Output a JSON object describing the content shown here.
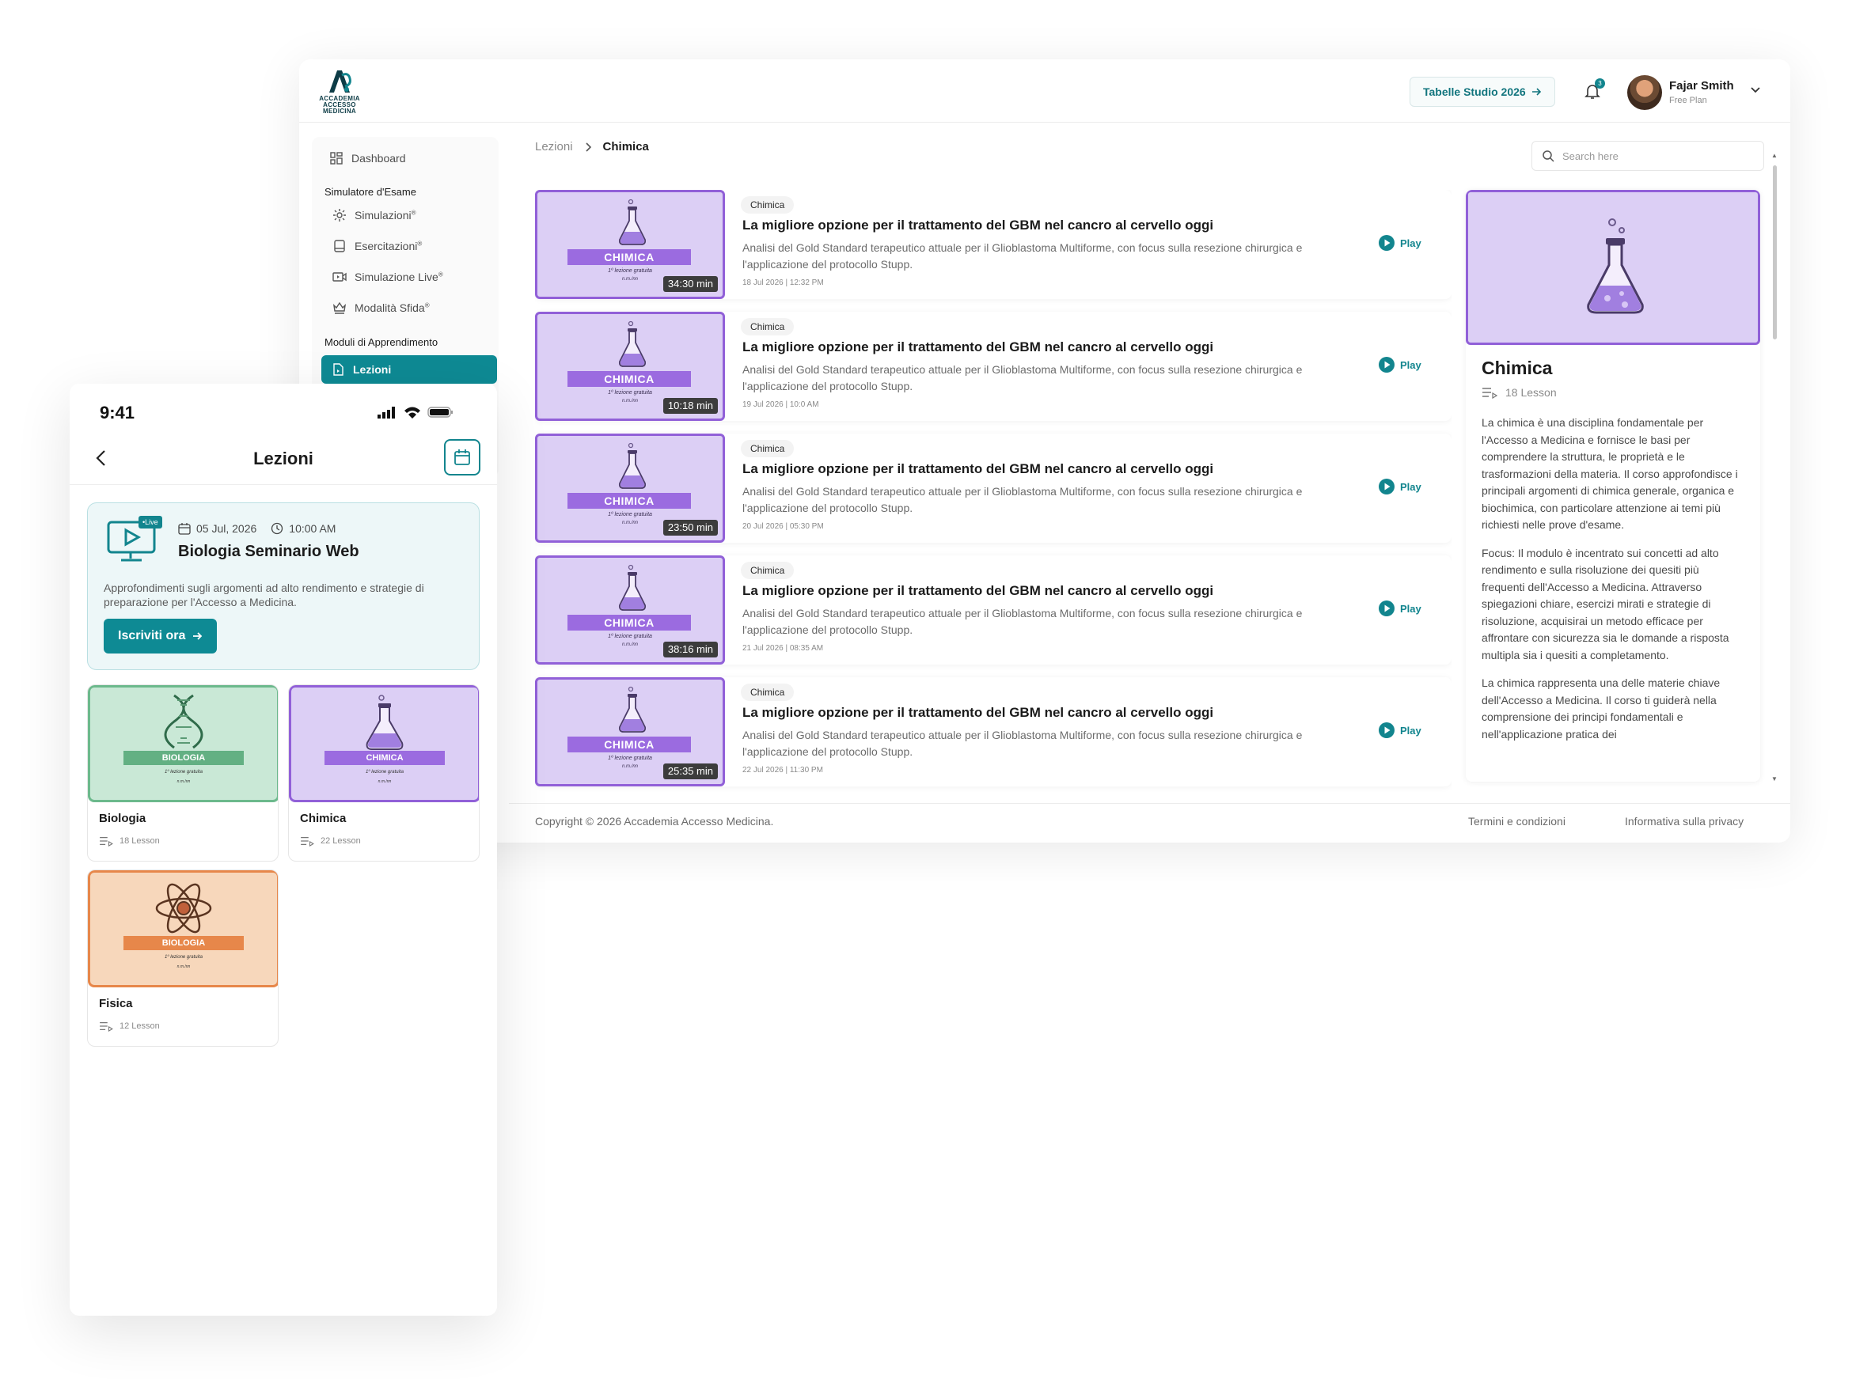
{
  "desktop": {
    "logo": {
      "lines": [
        "ACCADEMIA",
        "ACCESSO",
        "MEDICINA"
      ]
    },
    "header": {
      "cta_label": "Tabelle Studio 2026",
      "notification_count": "3",
      "user_name": "Fajar Smith",
      "user_plan": "Free Plan"
    },
    "sidebar": {
      "dashboard": "Dashboard",
      "section_exam": "Simulatore d'Esame",
      "simulazioni": "Simulazioni",
      "esercitazioni": "Esercitazioni",
      "simulazione_live": "Simulazione Live",
      "modalita_sfida": "Modalità Sfida",
      "section_learning": "Moduli di Apprendimento",
      "lezioni": "Lezioni",
      "reg_mark": "®"
    },
    "breadcrumb": {
      "root": "Lezioni",
      "current": "Chimica"
    },
    "search": {
      "placeholder": "Search here"
    },
    "thumb": {
      "band": "CHIMICA",
      "sub": "1º lezione gratuita",
      "sub2": "n.m./nn"
    },
    "play_label": "Play",
    "lessons": [
      {
        "tag": "Chimica",
        "title": "La migliore opzione per il trattamento del GBM nel cancro al cervello oggi",
        "desc": "Analisi del Gold Standard terapeutico attuale per il Glioblastoma Multiforme, con focus sulla resezione chirurgica e l'applicazione del protocollo Stupp.",
        "date": "18 Jul 2026 | 12:32 PM",
        "duration": "34:30 min"
      },
      {
        "tag": "Chimica",
        "title": "La migliore opzione per il trattamento del GBM nel cancro al cervello oggi",
        "desc": "Analisi del Gold Standard terapeutico attuale per il Glioblastoma Multiforme, con focus sulla resezione chirurgica e l'applicazione del protocollo Stupp.",
        "date": "19 Jul 2026 | 10:0 AM",
        "duration": "10:18 min"
      },
      {
        "tag": "Chimica",
        "title": "La migliore opzione per il trattamento del GBM nel cancro al cervello oggi",
        "desc": "Analisi del Gold Standard terapeutico attuale per il Glioblastoma Multiforme, con focus sulla resezione chirurgica e l'applicazione del protocollo Stupp.",
        "date": "20 Jul 2026 | 05:30 PM",
        "duration": "23:50 min"
      },
      {
        "tag": "Chimica",
        "title": "La migliore opzione per il trattamento del GBM nel cancro al cervello oggi",
        "desc": "Analisi del Gold Standard terapeutico attuale per il Glioblastoma Multiforme, con focus sulla resezione chirurgica e l'applicazione del protocollo Stupp.",
        "date": "21 Jul 2026 | 08:35 AM",
        "duration": "38:16 min"
      },
      {
        "tag": "Chimica",
        "title": "La migliore opzione per il trattamento del GBM nel cancro al cervello oggi",
        "desc": "Analisi del Gold Standard terapeutico attuale per il Glioblastoma Multiforme, con focus sulla resezione chirurgica e l'applicazione del protocollo Stupp.",
        "date": "22 Jul 2026 | 11:30 PM",
        "duration": "25:35 min"
      }
    ],
    "detail": {
      "title": "Chimica",
      "count": "18 Lesson",
      "p1": "La chimica è una disciplina fondamentale per l'Accesso a Medicina e fornisce le basi per comprendere la struttura, le proprietà e le trasformazioni della materia. Il corso approfondisce i principali argomenti di chimica generale, organica e biochimica, con particolare attenzione ai temi più richiesti nelle prove d'esame.",
      "p2_label": "Focus:",
      "p2": " Il modulo è incentrato sui concetti ad alto rendimento e sulla risoluzione dei quesiti più frequenti dell'Accesso a Medicina. Attraverso spiegazioni chiare, esercizi mirati e strategie di risoluzione, acquisirai un metodo efficace per affrontare con sicurezza sia le domande a risposta multipla sia i quesiti a completamento.",
      "p3": "La chimica rappresenta una delle materie chiave dell'Accesso a Medicina. Il corso ti guiderà nella comprensione dei principi fondamentali e nell'applicazione pratica dei"
    },
    "footer": {
      "copyright": "Copyright © 2026 Accademia Accesso Medicina.",
      "terms": "Termini e condizioni",
      "privacy": "Informativa sulla privacy"
    }
  },
  "mobile": {
    "time": "9:41",
    "title": "Lezioni",
    "webinar": {
      "live_badge": "•Live",
      "date": "05 Jul, 2026",
      "time": "10:00 AM",
      "title": "Biologia Seminario Web",
      "desc": "Approfondimenti sugli argomenti ad alto rendimento e strategie di preparazione per l'Accesso a Medicina.",
      "cta": "Iscriviti ora"
    },
    "subjects": [
      {
        "name": "Biologia",
        "count": "18 Lesson",
        "band": "BIOLOGIA",
        "sub": "1º lezione gratuita",
        "sub2": "n.m./nn"
      },
      {
        "name": "Chimica",
        "count": "22 Lesson",
        "band": "CHIMICA",
        "sub": "1º lezione gratuita",
        "sub2": "n.m./nn"
      },
      {
        "name": "Fisica",
        "count": "12 Lesson",
        "band": "BIOLOGIA",
        "sub": "1º lezione gratuita",
        "sub2": "n.m./nn"
      }
    ]
  },
  "colors": {
    "accent": "#0e8a94",
    "chimica_bg": "#dccff5",
    "chimica_border": "#9160d8",
    "biologia_bg": "#c9e8d6",
    "biologia_border": "#6cb98c",
    "fisica_bg": "#f7d7bb",
    "fisica_border": "#e7874a"
  },
  "icons": [
    "grid-icon",
    "gear-icon",
    "document-icon",
    "video-icon",
    "crown-icon",
    "file-icon",
    "bell-icon",
    "search-icon",
    "play-icon",
    "flask-icon",
    "dna-icon",
    "atom-icon",
    "calendar-icon",
    "clock-icon",
    "monitor-icon",
    "list-icon",
    "back-icon",
    "chevron-down-icon",
    "arrow-right-icon",
    "signal-icon",
    "wifi-icon",
    "battery-icon"
  ]
}
